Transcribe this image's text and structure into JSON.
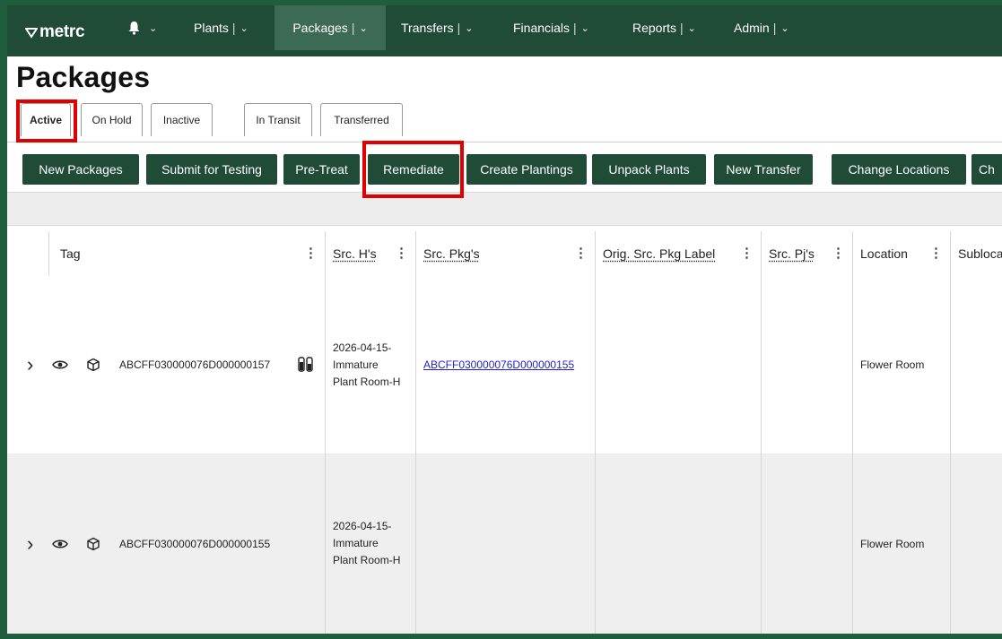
{
  "brand": {
    "logo_text": "metrc"
  },
  "nav": [
    {
      "label": "Plants"
    },
    {
      "label": "Packages"
    },
    {
      "label": "Transfers"
    },
    {
      "label": "Financials"
    },
    {
      "label": "Reports"
    },
    {
      "label": "Admin"
    }
  ],
  "page_title": "Packages",
  "tabs": [
    {
      "label": "Active"
    },
    {
      "label": "On Hold"
    },
    {
      "label": "Inactive"
    },
    {
      "label": "In Transit"
    },
    {
      "label": "Transferred"
    }
  ],
  "actions": [
    {
      "label": "New Packages"
    },
    {
      "label": "Submit for Testing"
    },
    {
      "label": "Pre-Treat"
    },
    {
      "label": "Remediate"
    },
    {
      "label": "Create Plantings"
    },
    {
      "label": "Unpack Plants"
    },
    {
      "label": "New Transfer"
    },
    {
      "label": "Change Locations"
    },
    {
      "label": "Ch"
    }
  ],
  "columns": [
    {
      "label": "Tag"
    },
    {
      "label": "Src. H's"
    },
    {
      "label": "Src. Pkg's"
    },
    {
      "label": "Orig. Src. Pkg Label"
    },
    {
      "label": "Src. Pj's"
    },
    {
      "label": "Location"
    },
    {
      "label": "Subloca"
    }
  ],
  "rows": [
    {
      "tag": "ABCFF030000076D000000157",
      "src_h_line1": "2026-04-15-",
      "src_h_line2": "Immature",
      "src_h_line3": "Plant Room-H",
      "src_pkg": "ABCFF030000076D000000155",
      "location": "Flower Room",
      "has_lab_icon": true
    },
    {
      "tag": "ABCFF030000076D000000155",
      "src_h_line1": "2026-04-15-",
      "src_h_line2": "Immature",
      "src_h_line3": "Plant Room-H",
      "src_pkg": "",
      "location": "Flower Room",
      "has_lab_icon": false
    }
  ],
  "colors": {
    "nav_bg": "#1f4b37",
    "button_bg": "#1f4b37",
    "highlight": "#e00000",
    "link": "#2222cc"
  },
  "icons": [
    "bell-icon",
    "chevron-down-icon",
    "chevron-right-icon",
    "eye-icon",
    "package-icon",
    "test-tubes-icon",
    "column-menu-icon"
  ]
}
